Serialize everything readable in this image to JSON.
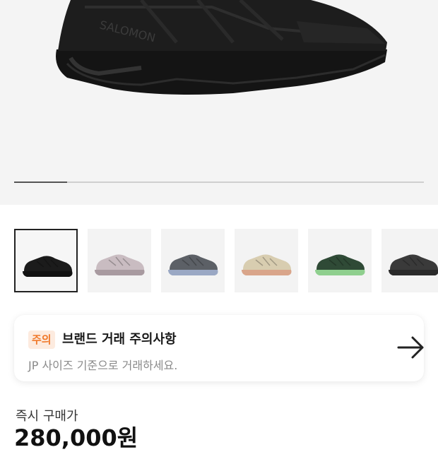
{
  "gallery": {
    "progress": 0.13,
    "selected_index": 0,
    "thumbnails": [
      {
        "name": "black",
        "upper": "#1b1b1b",
        "sole": "#111111"
      },
      {
        "name": "lilac-grey",
        "upper": "#c9bcc1",
        "sole": "#a89aa0"
      },
      {
        "name": "grey-blue",
        "upper": "#5c6066",
        "sole": "#9aa8c4"
      },
      {
        "name": "beige",
        "upper": "#d8cdb0",
        "sole": "#d9a58a"
      },
      {
        "name": "green",
        "upper": "#2f4a36",
        "sole": "#8fcf8e"
      },
      {
        "name": "dark-grey",
        "upper": "#3a3a3a",
        "sole": "#2a2a2a"
      }
    ]
  },
  "notice": {
    "badge": "주의",
    "title": "브랜드 거래 주의사항",
    "subtitle": "JP 사이즈 기준으로 거래하세요.",
    "arrow_icon": "arrow-right-icon"
  },
  "price": {
    "label": "즉시 구매가",
    "value": "280,000원"
  },
  "colors": {
    "badge_bg": "#fdebdf",
    "badge_text": "#f07a2c"
  }
}
